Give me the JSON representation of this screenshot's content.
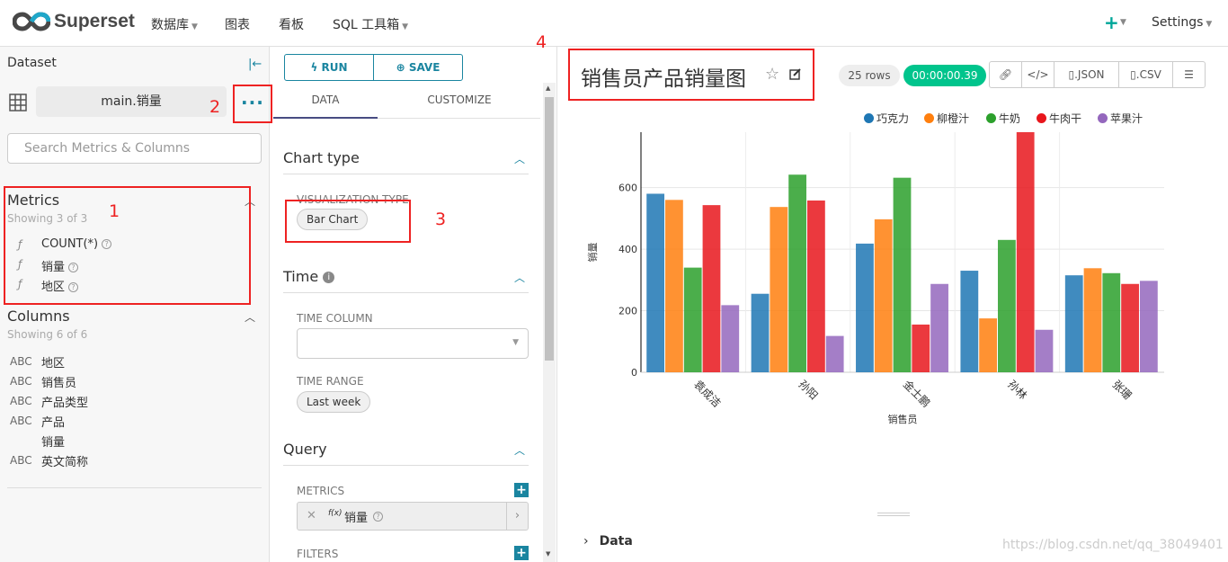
{
  "nav": {
    "brand": "Superset",
    "menus": [
      {
        "label": "数据库",
        "dropdown": true
      },
      {
        "label": "图表",
        "dropdown": false
      },
      {
        "label": "看板",
        "dropdown": false
      },
      {
        "label": "SQL 工具箱",
        "dropdown": true
      }
    ],
    "plus": "+",
    "settings": "Settings"
  },
  "dataset_panel": {
    "heading": "Dataset",
    "dataset_name": "main.销量",
    "search_placeholder": "Search Metrics & Columns",
    "metrics": {
      "title": "Metrics",
      "showing": "Showing 3 of 3",
      "items": [
        "COUNT(*)",
        "销量",
        "地区"
      ]
    },
    "columns": {
      "title": "Columns",
      "showing": "Showing 6 of 6",
      "items": [
        {
          "type": "ABC",
          "name": "地区"
        },
        {
          "type": "ABC",
          "name": "销售员"
        },
        {
          "type": "ABC",
          "name": "产品类型"
        },
        {
          "type": "ABC",
          "name": "产品"
        },
        {
          "type": "",
          "name": "销量"
        },
        {
          "type": "ABC",
          "name": "英文简称"
        }
      ]
    }
  },
  "control_panel": {
    "run": "RUN",
    "save": "SAVE",
    "tabs": [
      "DATA",
      "CUSTOMIZE"
    ],
    "active_tab": "DATA",
    "chart_type": {
      "title": "Chart type",
      "label": "VISUALIZATION TYPE",
      "value": "Bar Chart"
    },
    "time": {
      "title": "Time",
      "time_column_label": "TIME COLUMN",
      "time_range_label": "TIME RANGE",
      "time_range_value": "Last week"
    },
    "query": {
      "title": "Query",
      "metrics_label": "METRICS",
      "metric_value": "销量",
      "metric_fx": "f(x)",
      "filters_label": "FILTERS"
    }
  },
  "chart_header": {
    "title": "销售员产品销量图",
    "rows": "25 rows",
    "timer": "00:00:00.39",
    "buttons": [
      ".JSON",
      ".CSV"
    ]
  },
  "chart_data": {
    "type": "bar",
    "xlabel": "销售员",
    "ylabel": "销量",
    "categories": [
      "袁成洁",
      "孙阳",
      "金士鹏",
      "孙林",
      "张珊"
    ],
    "ylim": [
      0,
      780
    ],
    "yticks": [
      0,
      200,
      400,
      600
    ],
    "grid": true,
    "legend_position": "top-right",
    "series": [
      {
        "name": "巧克力",
        "color": "#1f77b4",
        "values": [
          580,
          255,
          418,
          330,
          315
        ]
      },
      {
        "name": "柳橙汁",
        "color": "#ff7f0e",
        "values": [
          560,
          537,
          497,
          175,
          338
        ]
      },
      {
        "name": "牛奶",
        "color": "#2ca02c",
        "values": [
          340,
          642,
          632,
          430,
          322
        ]
      },
      {
        "name": "牛肉干",
        "color": "#e8161c",
        "values": [
          543,
          558,
          155,
          780,
          287
        ]
      },
      {
        "name": "苹果汁",
        "color": "#9467bd",
        "values": [
          218,
          118,
          287,
          138,
          297
        ]
      }
    ]
  },
  "footer": {
    "data_label": "Data",
    "watermark": "https://blog.csdn.net/qq_38049401"
  },
  "annotations": [
    "1",
    "2",
    "3",
    "4"
  ]
}
